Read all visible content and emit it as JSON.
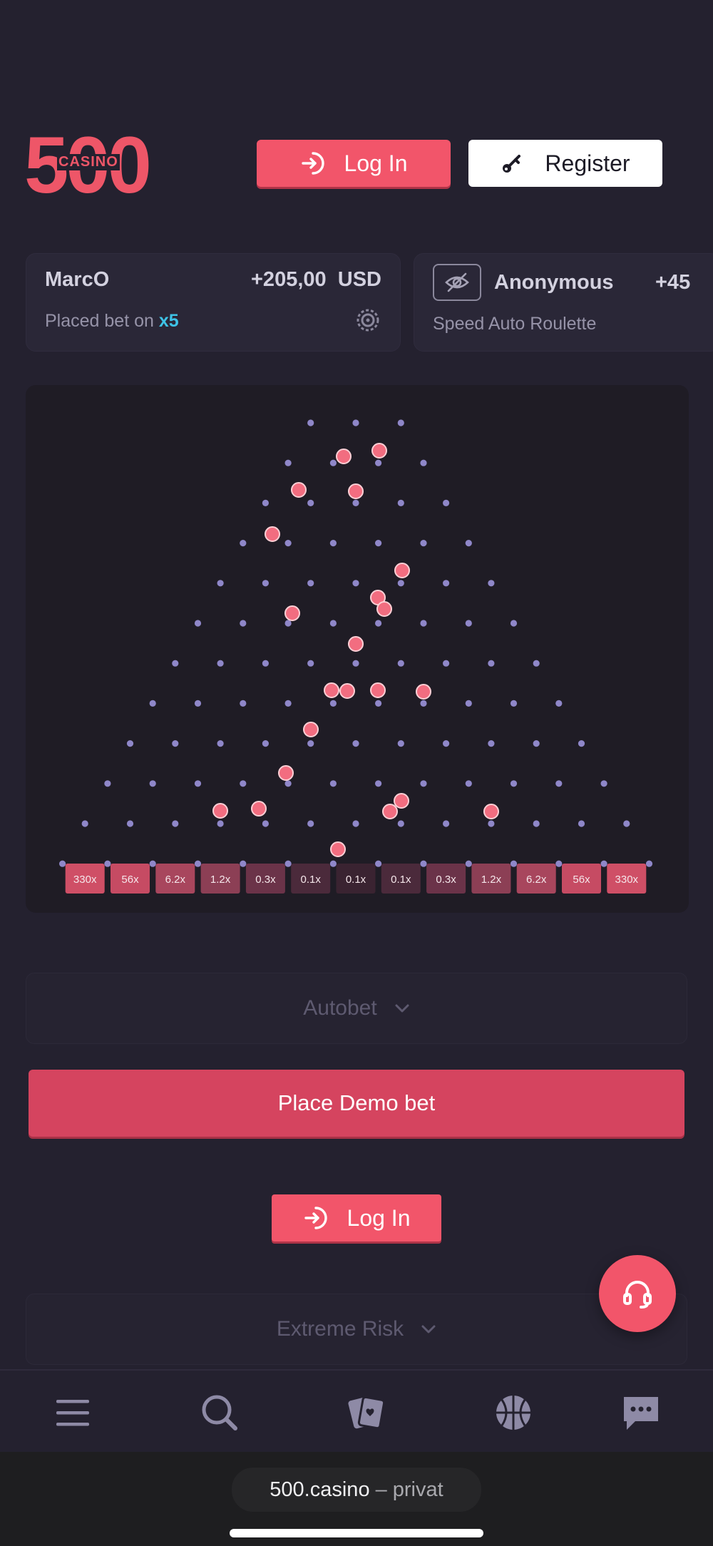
{
  "header": {
    "logo_number": "500",
    "logo_word": "CASINO",
    "login_label": "Log In",
    "register_label": "Register"
  },
  "ticker": [
    {
      "player": "MarcO",
      "amount": "+205,00",
      "currency": "USD",
      "action": "Placed bet on",
      "multiplier": "x5"
    },
    {
      "player": "Anonymous",
      "amount": "+45",
      "game": "Speed Auto Roulette"
    }
  ],
  "game": {
    "slots": [
      "330x",
      "56x",
      "6.2x",
      "1.2x",
      "0.3x",
      "0.1x",
      "0.1x",
      "0.1x",
      "0.3x",
      "1.2x",
      "6.2x",
      "56x",
      "330x"
    ],
    "slot_colors": [
      "#cf4f66",
      "#c64b63",
      "#a8465d",
      "#8c3f55",
      "#6b3349",
      "#4b2a3b",
      "#3a2331",
      "#4b2a3b",
      "#6b3349",
      "#8c3f55",
      "#a8465d",
      "#c64b63",
      "#cf4f66"
    ],
    "pin_color": "#8f87c9",
    "ball_color": "#f26d80"
  },
  "controls": {
    "autobet_label": "Autobet",
    "place_bet_label": "Place Demo bet",
    "login_label": "Log In",
    "risk_label": "Extreme Risk"
  },
  "browser": {
    "domain": "500.casino",
    "mode": "– privat"
  },
  "colors": {
    "accent": "#f2556a",
    "background": "#24212f",
    "multiplier": "#3ec3e6"
  }
}
